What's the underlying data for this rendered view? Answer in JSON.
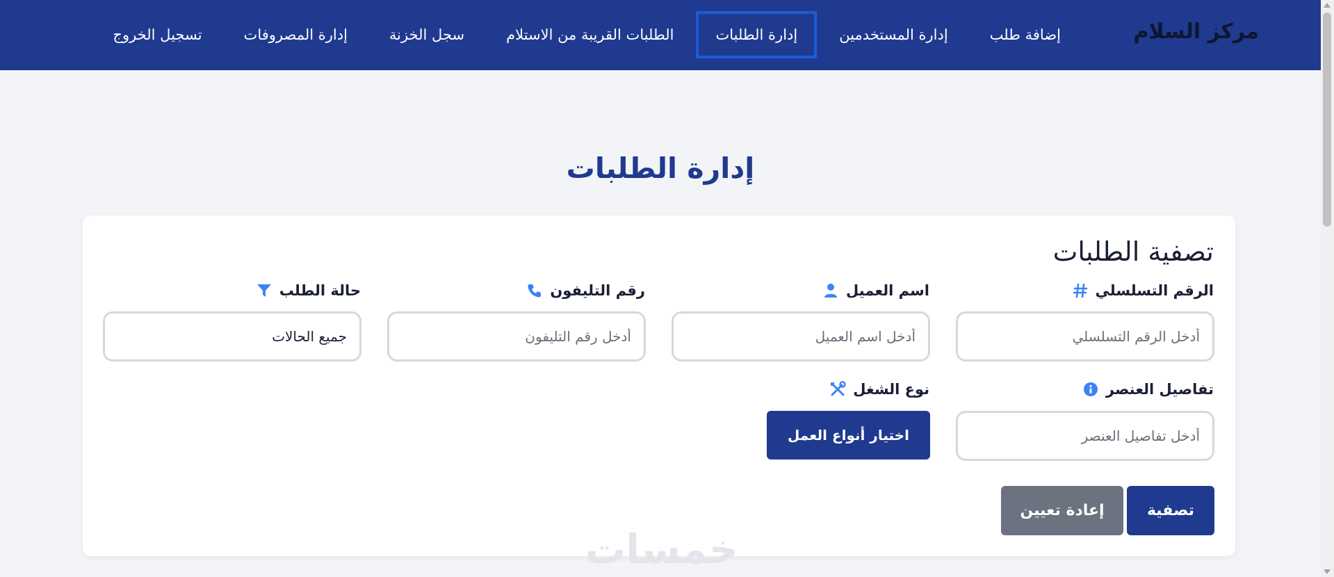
{
  "brand": "مركز السلام",
  "nav": {
    "items": [
      {
        "label": "إضافة طلب",
        "active": false
      },
      {
        "label": "إدارة المستخدمين",
        "active": false
      },
      {
        "label": "إدارة الطلبات",
        "active": true
      },
      {
        "label": "الطلبات القريبة من الاستلام",
        "active": false
      },
      {
        "label": "سجل الخزنة",
        "active": false
      },
      {
        "label": "إدارة المصروفات",
        "active": false
      },
      {
        "label": "تسجيل الخروج",
        "active": false
      }
    ]
  },
  "page_title": "إدارة الطلبات",
  "filter": {
    "title": "تصفية الطلبات",
    "serial": {
      "label": "الرقم التسلسلي",
      "placeholder": "أدخل الرقم التسلسلي",
      "icon": "hash-icon"
    },
    "customer": {
      "label": "اسم العميل",
      "placeholder": "أدخل اسم العميل",
      "icon": "user-icon"
    },
    "phone": {
      "label": "رقم التليفون",
      "placeholder": "أدخل رقم التليفون",
      "icon": "phone-icon"
    },
    "status": {
      "label": "حالة الطلب",
      "value": "جميع الحالات",
      "icon": "filter-icon"
    },
    "item_details": {
      "label": "تفاصيل العنصر",
      "placeholder": "أدخل تفاصيل العنصر",
      "icon": "info-icon"
    },
    "work_type": {
      "label": "نوع الشغل",
      "button": "اختيار أنواع العمل",
      "icon": "tools-icon"
    },
    "filter_button": "تصفية",
    "reset_button": "إعادة تعيين"
  },
  "watermark": "خمسات",
  "colors": {
    "primary": "#1f3a8f",
    "accent_icon": "#3b82f6",
    "secondary": "#6c727f"
  }
}
